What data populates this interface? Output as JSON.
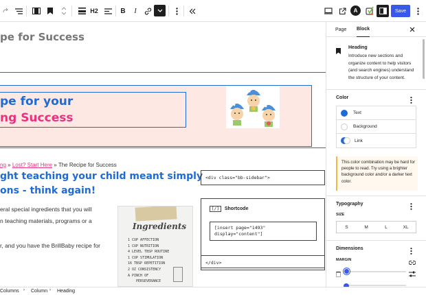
{
  "toolbar": {
    "heading_level": "H2",
    "publish_label": "Save"
  },
  "canvas": {
    "top_heading": "pe for Success",
    "hero_line1": "pe for your",
    "hero_line2": "ng Success",
    "breadcrumb": {
      "part1": "ng",
      "sep1": " » ",
      "link2": "Lost? Start Here",
      "sep2": " » ",
      "part3": "The Recipe for Success"
    },
    "blue_heading_line1": "ght teaching your child meant simply",
    "blue_heading_line2": "ons - think again!",
    "para_line1": "eral special ingredients that you will",
    "para_line2": "n teaching materials, programs or a",
    "para_line3": "r, and you have the BrillBaby recipe for",
    "ingredients_title": "Ingredients",
    "ingredients": [
      "1 CUP AFFECTION",
      "1 CUP NUTRITION",
      "4 LEVEL TBSP ROUTINE",
      "1 CUP STIMULATION",
      "16 TBSP REPETITION",
      "2 OZ CONSISTENCY",
      "A PINCH OF",
      "PERSEVERANCE"
    ],
    "code_open": "<div class=\"bb-sidebar\">",
    "shortcode_label": "Shortcode",
    "shortcode_value_line1": "[insert page=\"1493\"",
    "shortcode_value_line2": "display=\"content\"]",
    "code_close": "</div>"
  },
  "sidebar": {
    "tabs": [
      "Page",
      "Block"
    ],
    "block_name": "Heading",
    "block_description": "Introduce new sections and organize content to help visitors (and search engines) understand the structure of your content.",
    "color_title": "Color",
    "color_items": [
      {
        "label": "Text",
        "swatch": "#1e6ad6"
      },
      {
        "label": "Background",
        "swatch": "#ffffff"
      },
      {
        "label": "Link",
        "swatch": "#1e6ad6"
      }
    ],
    "warning": "This color combination may be hard for people to read. Try using a brighter background color and/or a darker text color.",
    "typography_title": "Typography",
    "size_label": "SIZE",
    "sizes": [
      "S",
      "M",
      "L",
      "XL"
    ],
    "dimensions_title": "Dimensions",
    "margin_label": "MARGIN"
  },
  "statusbar": {
    "crumbs": [
      "Columns",
      "Column",
      "Heading"
    ]
  },
  "colors": {
    "accent": "#3858e9",
    "hero_bg": "#fde8e4",
    "hero_border": "#1e6ad6",
    "warning_bg": "#fef8ee",
    "warning_border": "#f0b849"
  }
}
